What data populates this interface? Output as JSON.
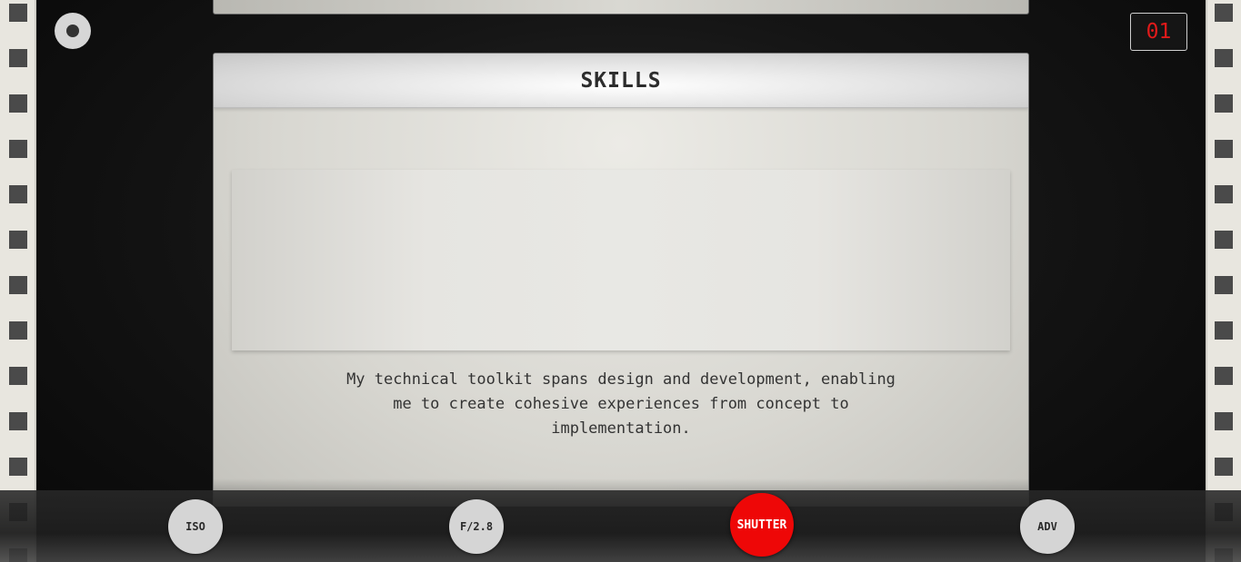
{
  "section": {
    "title": "SKILLS",
    "description": "My technical toolkit spans design and development, enabling me to create cohesive experiences from concept to implementation."
  },
  "frame_counter": "01",
  "controls": {
    "iso_label": "ISO",
    "aperture_label": "F/2.8",
    "shutter_label": "SHUTTER",
    "advance_label": "ADV"
  },
  "colors": {
    "shutter": "#ee0707",
    "counter_text": "#e01a1a",
    "film": "#e8e6df"
  }
}
